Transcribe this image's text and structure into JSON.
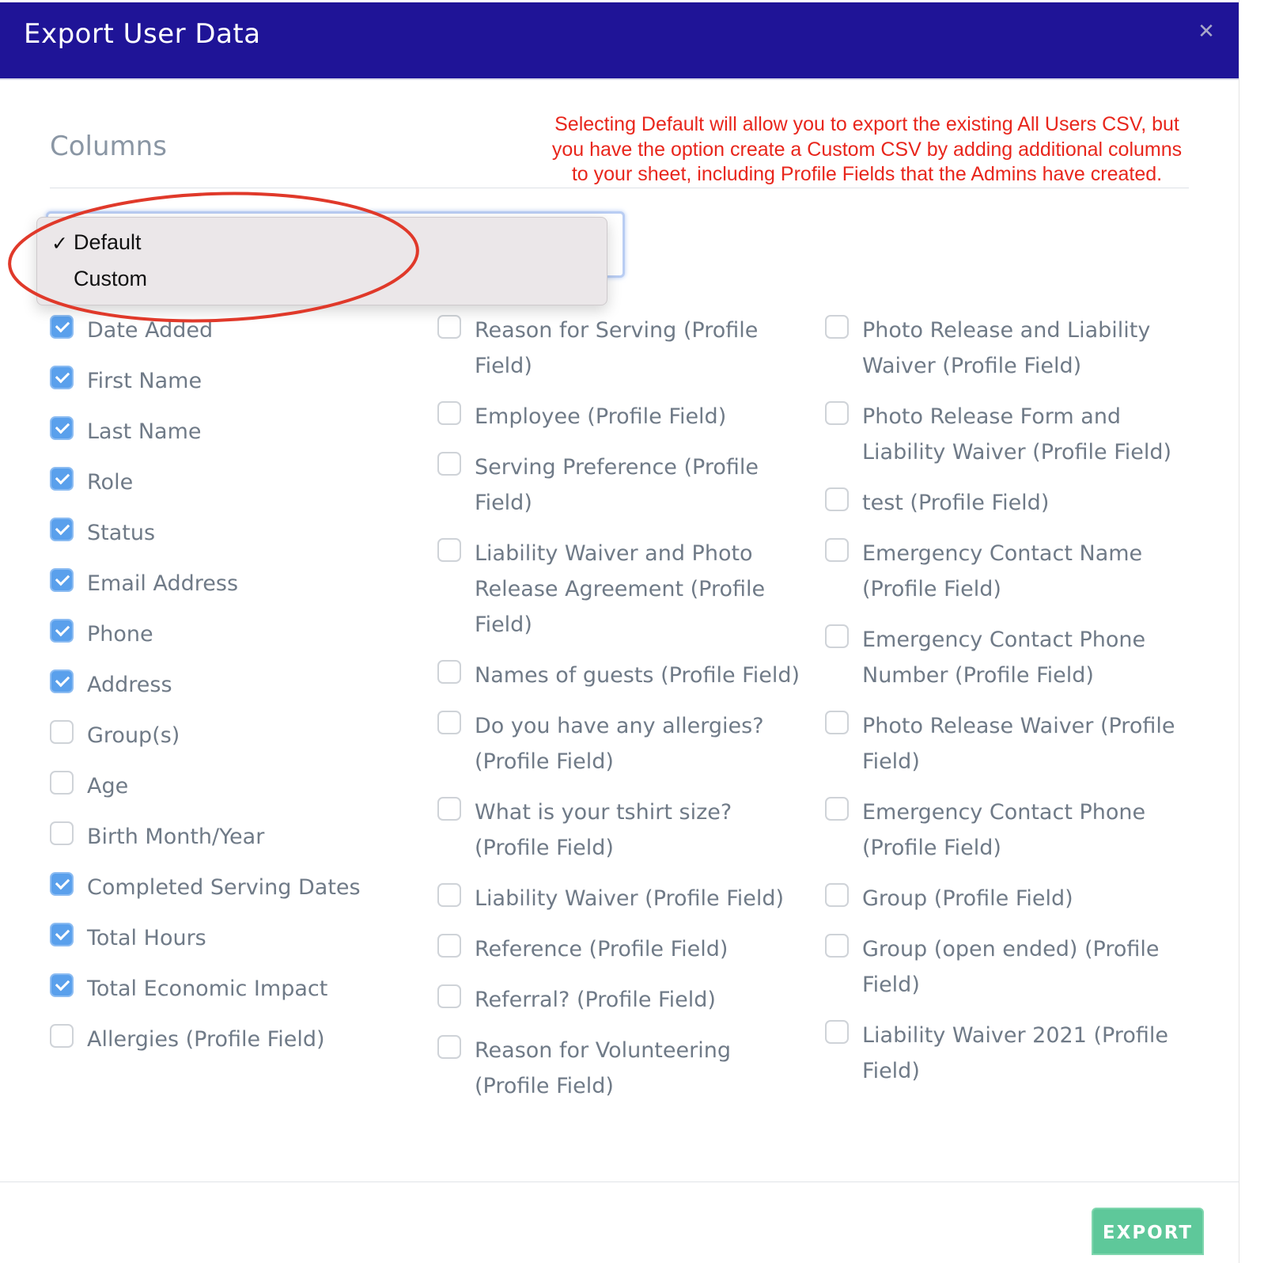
{
  "modal": {
    "title": "Export User Data",
    "close_label": "✕"
  },
  "section": {
    "title": "Columns"
  },
  "annotation": {
    "note": "Selecting Default will allow you to export the existing All Users CSV, but you have the option create a Custom CSV by adding additional columns to your sheet, including Profile Fields that the Admins have created.",
    "color": "#e8261c"
  },
  "select": {
    "selected": "Default",
    "options": [
      {
        "label": "Default",
        "checked": true,
        "mark": "✓"
      },
      {
        "label": "Custom",
        "checked": false,
        "mark": ""
      }
    ]
  },
  "columns": [
    [
      {
        "label": "Date Added",
        "checked": true
      },
      {
        "label": "First Name",
        "checked": true
      },
      {
        "label": "Last Name",
        "checked": true
      },
      {
        "label": "Role",
        "checked": true
      },
      {
        "label": "Status",
        "checked": true
      },
      {
        "label": "Email Address",
        "checked": true
      },
      {
        "label": "Phone",
        "checked": true
      },
      {
        "label": "Address",
        "checked": true
      },
      {
        "label": "Group(s)",
        "checked": false
      },
      {
        "label": "Age",
        "checked": false
      },
      {
        "label": "Birth Month/Year",
        "checked": false
      },
      {
        "label": "Completed Serving Dates",
        "checked": true
      },
      {
        "label": "Total Hours",
        "checked": true
      },
      {
        "label": "Total Economic Impact",
        "checked": true
      },
      {
        "label": "Allergies (Profile Field)",
        "checked": false
      }
    ],
    [
      {
        "label": "Reason for Serving (Profile Field)",
        "checked": false
      },
      {
        "label": "Employee (Profile Field)",
        "checked": false
      },
      {
        "label": "Serving Preference (Profile Field)",
        "checked": false
      },
      {
        "label": "Liability Waiver and Photo Release Agreement (Profile Field)",
        "checked": false
      },
      {
        "label": "Names of guests (Profile Field)",
        "checked": false
      },
      {
        "label": "Do you have any allergies? (Profile Field)",
        "checked": false
      },
      {
        "label": "What is your tshirt size? (Profile Field)",
        "checked": false
      },
      {
        "label": "Liability Waiver (Profile Field)",
        "checked": false
      },
      {
        "label": "Reference (Profile Field)",
        "checked": false
      },
      {
        "label": "Referral? (Profile Field)",
        "checked": false
      },
      {
        "label": "Reason for Volunteering (Profile Field)",
        "checked": false
      }
    ],
    [
      {
        "label": "Photo Release and Liability Waiver (Profile Field)",
        "checked": false
      },
      {
        "label": "Photo Release Form and Liability Waiver (Profile Field)",
        "checked": false
      },
      {
        "label": "test (Profile Field)",
        "checked": false
      },
      {
        "label": "Emergency Contact Name (Profile Field)",
        "checked": false
      },
      {
        "label": "Emergency Contact Phone Number (Profile Field)",
        "checked": false
      },
      {
        "label": "Photo Release Waiver (Profile Field)",
        "checked": false
      },
      {
        "label": "Emergency Contact Phone (Profile Field)",
        "checked": false
      },
      {
        "label": "Group (Profile Field)",
        "checked": false
      },
      {
        "label": "Group (open ended) (Profile Field)",
        "checked": false
      },
      {
        "label": "Liability Waiver 2021 (Profile Field)",
        "checked": false
      }
    ]
  ],
  "footer": {
    "export_label": "EXPORT",
    "export_color": "#5ec89a"
  },
  "colors": {
    "header_bg": "#1f1497",
    "checkbox_checked": "#5aa0ec"
  }
}
